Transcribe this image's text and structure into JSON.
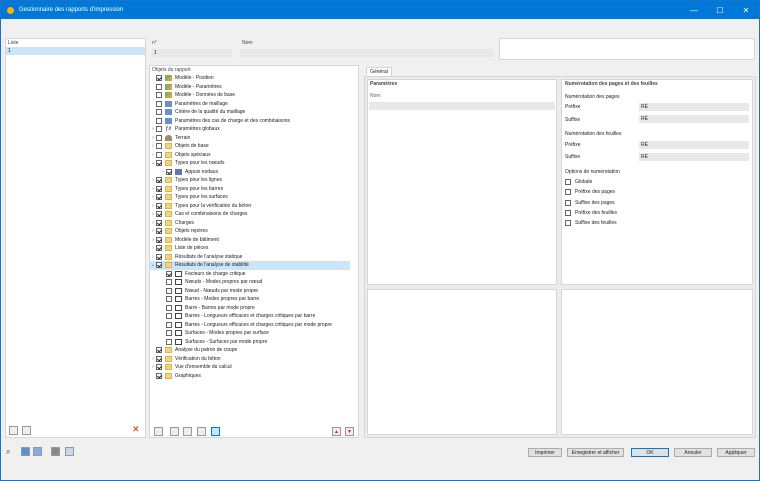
{
  "window": {
    "title": "Gestionnaire des rapports d'impression"
  },
  "list": {
    "header": "Liste",
    "items": [
      "1"
    ]
  },
  "number": {
    "header": "n°",
    "value": "1"
  },
  "name": {
    "header": "Nom",
    "value": ""
  },
  "objects": {
    "header": "Objets du rapport",
    "rows": [
      {
        "label": "Modèle - Position",
        "checked": true,
        "level": 1,
        "icon": "model-icon",
        "arrow": ""
      },
      {
        "label": "Modèle - Paramètres",
        "checked": false,
        "level": 1,
        "icon": "model-icon",
        "arrow": ""
      },
      {
        "label": "Modèle - Données de base",
        "checked": false,
        "level": 1,
        "icon": "model-icon",
        "arrow": ""
      },
      {
        "label": "Paramètres de maillage",
        "checked": false,
        "level": 1,
        "icon": "mesh-icon",
        "arrow": ""
      },
      {
        "label": "Critère de la qualité du maillage",
        "checked": false,
        "level": 1,
        "icon": "mesh-icon",
        "arrow": ""
      },
      {
        "label": "Paramètres des cas de charge et des combinaisons",
        "checked": false,
        "level": 1,
        "icon": "mesh-icon",
        "arrow": ""
      },
      {
        "label": "Paramètres globaux",
        "checked": false,
        "level": 1,
        "icon": "fx-icon",
        "arrow": "›"
      },
      {
        "label": "Terrain",
        "checked": false,
        "level": 1,
        "icon": "terrain-icon",
        "arrow": "›"
      },
      {
        "label": "Objets de base",
        "checked": false,
        "level": 1,
        "icon": "folder-icon",
        "arrow": "›"
      },
      {
        "label": "Objets spéciaux",
        "checked": false,
        "level": 1,
        "icon": "folder-icon",
        "arrow": "›"
      },
      {
        "label": "Types pour les nœuds",
        "checked": true,
        "level": 1,
        "icon": "folder-icon",
        "arrow": "⌄"
      },
      {
        "label": "Appuis nodaux",
        "checked": true,
        "level": 2,
        "icon": "support-icon",
        "arrow": "›"
      },
      {
        "label": "Types pour les lignes",
        "checked": true,
        "level": 1,
        "icon": "folder-icon",
        "arrow": "›"
      },
      {
        "label": "Types pour les barres",
        "checked": true,
        "level": 1,
        "icon": "folder-icon",
        "arrow": "›"
      },
      {
        "label": "Types pour les surfaces",
        "checked": true,
        "level": 1,
        "icon": "folder-icon",
        "arrow": "›"
      },
      {
        "label": "Types pour la vérification du béton",
        "checked": true,
        "level": 1,
        "icon": "folder-icon",
        "arrow": "›"
      },
      {
        "label": "Cas et combinaisons de charges",
        "checked": true,
        "level": 1,
        "icon": "folder-icon",
        "arrow": "›"
      },
      {
        "label": "Charges",
        "checked": true,
        "level": 1,
        "icon": "folder-icon",
        "arrow": "›"
      },
      {
        "label": "Objets repères",
        "checked": true,
        "level": 1,
        "icon": "folder-icon",
        "arrow": "›"
      },
      {
        "label": "Modèle de bâtiment",
        "checked": true,
        "level": 1,
        "icon": "folder-icon",
        "arrow": "›"
      },
      {
        "label": "Liste de pièces",
        "checked": true,
        "level": 1,
        "icon": "folder-icon",
        "arrow": "›"
      },
      {
        "label": "Résultats de l'analyse statique",
        "checked": true,
        "level": 1,
        "icon": "folder-icon",
        "arrow": "›"
      },
      {
        "label": "Résultats de l'analyse de stabilité",
        "checked": true,
        "level": 1,
        "icon": "folder-icon",
        "arrow": "⌄",
        "selected": true
      },
      {
        "label": "Facteurs de charge critique",
        "checked": true,
        "level": 2,
        "icon": "mode-icon",
        "arrow": ""
      },
      {
        "label": "Nœuds - Modes propres par nœud",
        "checked": false,
        "level": 2,
        "icon": "mode-icon",
        "arrow": ""
      },
      {
        "label": "Nœud - Nœuds par mode propre",
        "checked": false,
        "level": 2,
        "icon": "mode-icon",
        "arrow": ""
      },
      {
        "label": "Barres - Modes propres par barre",
        "checked": false,
        "level": 2,
        "icon": "mode-icon",
        "arrow": ""
      },
      {
        "label": "Barre - Barres par mode propre",
        "checked": false,
        "level": 2,
        "icon": "mode-icon",
        "arrow": ""
      },
      {
        "label": "Barres - Longueurs efficaces et charges critiques par barre",
        "checked": false,
        "level": 2,
        "icon": "mode-icon",
        "arrow": ""
      },
      {
        "label": "Barres - Longueurs efficaces et charges critiques par mode propre",
        "checked": false,
        "level": 2,
        "icon": "mode-icon",
        "arrow": ""
      },
      {
        "label": "Surfaces - Modes propres par surface",
        "checked": false,
        "level": 2,
        "icon": "mode-icon",
        "arrow": ""
      },
      {
        "label": "Surfaces - Surfaces par mode propre",
        "checked": false,
        "level": 2,
        "icon": "mode-icon",
        "arrow": ""
      },
      {
        "label": "Analyse du patron de coupe",
        "checked": true,
        "level": 1,
        "icon": "folder-icon",
        "arrow": ""
      },
      {
        "label": "Vérification du béton",
        "checked": true,
        "level": 1,
        "icon": "folder-icon",
        "arrow": "›"
      },
      {
        "label": "Vue d'ensemble du calcul",
        "checked": true,
        "level": 1,
        "icon": "folder-icon",
        "arrow": "›"
      },
      {
        "label": "Graphiques",
        "checked": true,
        "level": 1,
        "icon": "folder-icon",
        "arrow": ""
      }
    ]
  },
  "tabs": {
    "general": "Général"
  },
  "params": {
    "header": "Paramètres",
    "name_label": "Nom"
  },
  "numbering": {
    "header": "Numérotation des pages et des feuilles",
    "pages_header": "Numérotation des pages",
    "sheets_header": "Numérotation des feuilles",
    "prefix_label": "Préfixe",
    "suffix_label": "Suffixe",
    "pages_prefix": "RÉ",
    "pages_suffix": "RÉ",
    "sheets_prefix": "RÉ",
    "sheets_suffix": "RÉ",
    "options_header": "Options de numérotation",
    "options": [
      "Globale",
      "Préfixe des pages",
      "Suffixe des pages",
      "Préfixe des feuilles",
      "Suffixe des feuilles"
    ]
  },
  "buttons": {
    "print": "Imprimer",
    "save_show": "Enregistrer et afficher",
    "ok": "OK",
    "cancel": "Annuler",
    "apply": "Appliquer"
  },
  "colors": {
    "accent": "#0078d7",
    "selection": "#cce4f7",
    "folder": "#f5d37a"
  }
}
